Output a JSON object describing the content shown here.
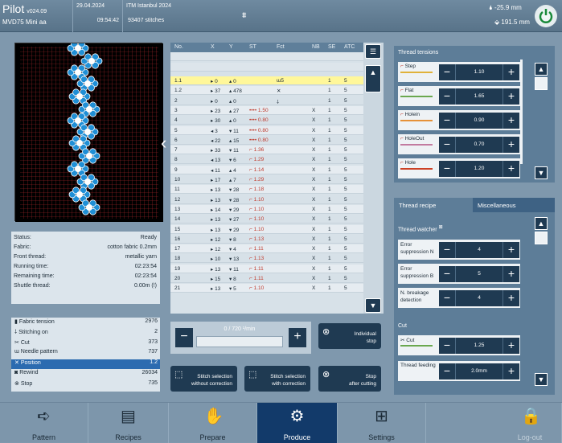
{
  "header": {
    "app_name": "Pilot",
    "version": "v024.09",
    "machine": "MVD75 Mini aa",
    "date": "29.04.2024",
    "time": "09:54:42",
    "job": "ITM Istanbul 2024",
    "stitches": "93407 stitches",
    "temperature": "-25.9 mm",
    "position": "191.5 mm"
  },
  "status": {
    "rows": [
      {
        "k": "Status:",
        "v": "Ready"
      },
      {
        "k": "Fabric:",
        "v": "cotton fabric 0.2mm"
      },
      {
        "k": "Front thread:",
        "v": "metallic yarn"
      },
      {
        "k": "Running time:",
        "v": "02:23:54"
      },
      {
        "k": "Remaining time:",
        "v": "02:23:54"
      },
      {
        "k": "Shuttle thread:",
        "v": "0.00m (!)"
      }
    ]
  },
  "counters": {
    "rows": [
      {
        "k": "Fabric tension",
        "v": "2976"
      },
      {
        "k": "Stitching on",
        "v": "2"
      },
      {
        "k": "Cut",
        "v": "373"
      },
      {
        "k": "Needle pattern",
        "v": "737"
      },
      {
        "k": "Position",
        "v": "1.2"
      },
      {
        "k": "Rewind",
        "v": "26034"
      },
      {
        "k": "Stop",
        "v": "735"
      }
    ]
  },
  "table": {
    "headers": [
      "No.",
      "X",
      "Y",
      "ST",
      "Fct",
      "NB",
      "SE",
      "ATC"
    ],
    "rows": [
      [
        "1.1",
        "▸ 0",
        "▴ 0",
        "",
        "ɯ5",
        "",
        "1",
        "5"
      ],
      [
        "1.2",
        "▸ 37",
        "▴ 478",
        "",
        "✕",
        "",
        "1",
        "5"
      ],
      [
        "2",
        "▸ 0",
        "▴ 0",
        "",
        "⸸",
        "",
        "1",
        "5"
      ],
      [
        "3",
        "▸ 23",
        "▴ 27",
        "•••• 1.50",
        "",
        "X",
        "1",
        "5"
      ],
      [
        "4",
        "▸ 30",
        "▴ 0",
        "•••• 0.80",
        "",
        "X",
        "1",
        "5"
      ],
      [
        "5",
        "◂ 3",
        "▾ 11",
        "•••• 0.80",
        "",
        "X",
        "1",
        "5"
      ],
      [
        "6",
        "◂ 22",
        "▴ 15",
        "•••• 0.80",
        "",
        "X",
        "1",
        "5"
      ],
      [
        "7",
        "▸ 33",
        "▾ 11",
        "⌐ 1.36",
        "",
        "X",
        "1",
        "5"
      ],
      [
        "8",
        "◂ 13",
        "▾ 6",
        "⌐ 1.29",
        "",
        "X",
        "1",
        "5"
      ],
      [
        "9",
        "◂ 11",
        "▴ 4",
        "⌐ 1.14",
        "",
        "X",
        "1",
        "5"
      ],
      [
        "10",
        "▸ 17",
        "▴ 7",
        "⌐ 1.29",
        "",
        "X",
        "1",
        "5"
      ],
      [
        "11",
        "▸ 13",
        "▾ 28",
        "⌐ 1.18",
        "",
        "X",
        "1",
        "5"
      ],
      [
        "12",
        "▸ 13",
        "▾ 28",
        "⌐ 1.10",
        "",
        "X",
        "1",
        "5"
      ],
      [
        "13",
        "▸ 14",
        "▾ 29",
        "⌐ 1.10",
        "",
        "X",
        "1",
        "5"
      ],
      [
        "14",
        "▸ 13",
        "▾ 27",
        "⌐ 1.10",
        "",
        "X",
        "1",
        "5"
      ],
      [
        "15",
        "▸ 13",
        "▾ 29",
        "⌐ 1.10",
        "",
        "X",
        "1",
        "5"
      ],
      [
        "16",
        "▸ 12",
        "▾ 8",
        "⌐ 1.13",
        "",
        "X",
        "1",
        "5"
      ],
      [
        "17",
        "▸ 12",
        "▾ 4",
        "⌐ 1.11",
        "",
        "X",
        "1",
        "5"
      ],
      [
        "18",
        "▸ 10",
        "▾ 13",
        "⌐ 1.13",
        "",
        "X",
        "1",
        "5"
      ],
      [
        "19",
        "▸ 13",
        "▾ 11",
        "⌐ 1.11",
        "",
        "X",
        "1",
        "5"
      ],
      [
        "20",
        "▸ 15",
        "▾ 8",
        "⌐ 1.11",
        "",
        "X",
        "1",
        "5"
      ],
      [
        "21",
        "▸ 13",
        "▾ 5",
        "⌐ 1.10",
        "",
        "X",
        "1",
        "5"
      ]
    ]
  },
  "speed": {
    "label": "0 / 720 ¹/min"
  },
  "buttons": {
    "individual_stop": [
      "Individual",
      "stop"
    ],
    "stitch_sel_no": [
      "Stitch selection",
      "without correction"
    ],
    "stitch_sel_with": [
      "Stitch selection",
      "with correction"
    ],
    "stop_after": [
      "Stop",
      "after cutting"
    ]
  },
  "tensions": {
    "title": "Thread tensions",
    "rows": [
      {
        "label": "Step",
        "value": "1.10",
        "color": "#e0b23a"
      },
      {
        "label": "Flat",
        "value": "1.65",
        "color": "#6aa84f"
      },
      {
        "label": "Holein",
        "value": "0.90",
        "color": "#e69138"
      },
      {
        "label": "HoleOut",
        "value": "0.70",
        "color": "#c27ba0"
      },
      {
        "label": "Hole",
        "value": "1.20",
        "color": "#cc4125"
      }
    ]
  },
  "recipe": {
    "tab1": "Thread recipe",
    "tab2": "Miscellaneous",
    "watcher_title": "Thread watcher",
    "watch_rows": [
      {
        "label": "Error suppression N",
        "value": "4"
      },
      {
        "label": "Error suppression B",
        "value": "5"
      },
      {
        "label": "N. breakage detection",
        "value": "4"
      }
    ],
    "cut_title": "Cut",
    "cut": {
      "label": "Cut",
      "value": "1.25"
    },
    "feed": {
      "label": "Thread feeding",
      "value": "2.0mm"
    }
  },
  "nav": [
    "Pattern",
    "Recipes",
    "Prepare",
    "Produce",
    "Settings",
    "Log-out"
  ],
  "icons": [
    "power-icon",
    "pattern-icon",
    "recipes-icon",
    "prepare-icon",
    "produce-icon",
    "settings-icon",
    "logout-icon"
  ]
}
